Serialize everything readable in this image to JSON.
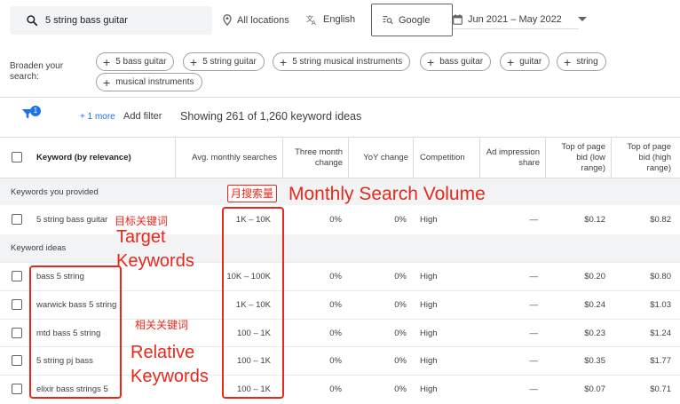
{
  "topbar": {
    "search_value": "5 string bass guitar",
    "location": "All locations",
    "language": "English",
    "network": "Google",
    "date_range": "Jun 2021 – May 2022"
  },
  "broaden": {
    "label": "Broaden your search:",
    "chips": [
      "5 bass guitar",
      "5 string guitar",
      "5 string musical instruments",
      "bass guitar",
      "guitar",
      "string",
      "musical instruments"
    ]
  },
  "filterbar": {
    "badge": "1",
    "more": "+ 1 more",
    "add_filter": "Add filter",
    "showing": "Showing 261 of 1,260 keyword ideas"
  },
  "table": {
    "headers": {
      "keyword": "Keyword (by relevance)",
      "avg": "Avg. monthly searches",
      "three_month": "Three month change",
      "yoy": "YoY change",
      "competition": "Competition",
      "ad_share": "Ad impression share",
      "bid_low": "Top of page bid (low range)",
      "bid_high": "Top of page bid (high range)"
    },
    "provided_label": "Keywords you provided",
    "ideas_label": "Keyword ideas",
    "provided_rows": [
      {
        "keyword": "5 string bass guitar",
        "avg": "1K – 10K",
        "three": "0%",
        "yoy": "0%",
        "comp": "High",
        "share": "—",
        "low": "$0.12",
        "high": "$0.82"
      }
    ],
    "idea_rows": [
      {
        "keyword": "bass 5 string",
        "avg": "10K – 100K",
        "three": "0%",
        "yoy": "0%",
        "comp": "High",
        "share": "—",
        "low": "$0.20",
        "high": "$0.80"
      },
      {
        "keyword": "warwick bass 5 string",
        "avg": "1K – 10K",
        "three": "0%",
        "yoy": "0%",
        "comp": "High",
        "share": "—",
        "low": "$0.24",
        "high": "$1.03"
      },
      {
        "keyword": "mtd bass 5 string",
        "avg": "100 – 1K",
        "three": "0%",
        "yoy": "0%",
        "comp": "High",
        "share": "—",
        "low": "$0.23",
        "high": "$1.24"
      },
      {
        "keyword": "5 string pj bass",
        "avg": "100 – 1K",
        "three": "0%",
        "yoy": "0%",
        "comp": "High",
        "share": "—",
        "low": "$0.35",
        "high": "$1.77"
      },
      {
        "keyword": "elixir bass strings 5",
        "avg": "100 – 1K",
        "three": "0%",
        "yoy": "0%",
        "comp": "High",
        "share": "—",
        "low": "$0.07",
        "high": "$0.71"
      }
    ]
  },
  "annotations": {
    "monthly_cn": "月搜索量",
    "monthly_en": "Monthly Search Volume",
    "target_cn": "目标关键词",
    "target_en_1": "Target",
    "target_en_2": "Keywords",
    "relative_cn": "相关关键词",
    "relative_en_1": "Relative",
    "relative_en_2": "Keywords",
    "color": "#e8281c"
  }
}
